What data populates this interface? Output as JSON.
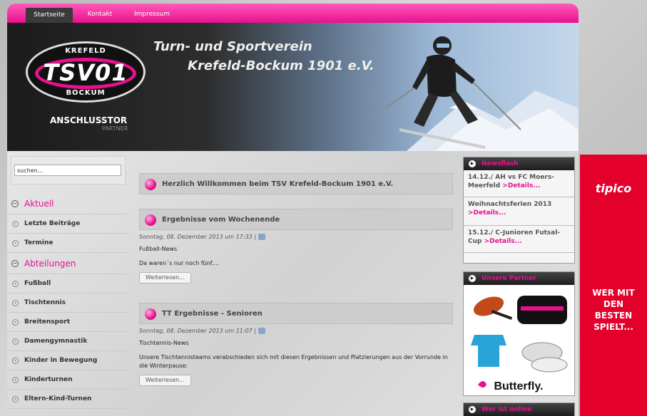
{
  "nav": {
    "items": [
      "Startseite",
      "Kontakt",
      "Impressum"
    ],
    "active": "Startseite"
  },
  "header": {
    "logo_top": "KREFELD",
    "logo_main": "TSV01",
    "logo_bottom": "BOCKUM",
    "title_line1": "Turn- und Sportverein",
    "title_line2": "Krefeld-Bockum 1901 e.V.",
    "sponsor": "ANSCHLUSSTOR",
    "sponsor_sub": "PARTNER"
  },
  "search": {
    "placeholder": "suchen..."
  },
  "sidebar": {
    "section1": "Aktuell",
    "items1": [
      "Letzte Beiträge",
      "Termine"
    ],
    "section2": "Abteilungen",
    "items2": [
      "Fußball",
      "Tischtennis",
      "Breitensport",
      "Damengymnastik",
      "Kinder in Bewegung",
      "Kinderturnen",
      "Eltern-Kind-Turnen"
    ]
  },
  "main": {
    "welcome": "Herzlich Willkommen beim TSV Krefeld-Bockum 1901 e.V.",
    "articles": [
      {
        "title": "Ergebnisse vom Wochenende",
        "meta": "Sonntag, 08. Dezember 2013 um 17:33 |",
        "category": "Fußball-News",
        "teaser": "Da waren´s nur noch fünf....",
        "more": "Weiterlesen..."
      },
      {
        "title": "TT Ergebnisse - Senioren",
        "meta": "Sonntag, 08. Dezember 2013 um 11:07 |",
        "category": "Tischtennis-News",
        "teaser": "Unsere Tischtennisteams verabschieden sich mit diesen Ergebnissen und Platzierungen aus der Vorrunde in die Winterpause:",
        "more": "Weiterlesen..."
      }
    ]
  },
  "newsflash": {
    "title": "Newsflash",
    "items": [
      {
        "text": "14.12./ AH vs FC Moers-Meerfeld",
        "link": ">Details..."
      },
      {
        "text": "Weihnachtsferien 2013",
        "link": ">Details..."
      },
      {
        "text": "15.12./ C-Junioren Futsal-Cup",
        "link": ">Details..."
      }
    ]
  },
  "partner": {
    "title": "Unsere Partner",
    "brand": "Butterfly."
  },
  "online": {
    "title": "Wer ist online"
  },
  "ad": {
    "brand": "tipico",
    "line1": "WER MIT",
    "line2": "DEN",
    "line3": "BESTEN",
    "line4": "SPIELT..."
  },
  "colors": {
    "accent": "#e8108f",
    "ad": "#e3002b"
  }
}
